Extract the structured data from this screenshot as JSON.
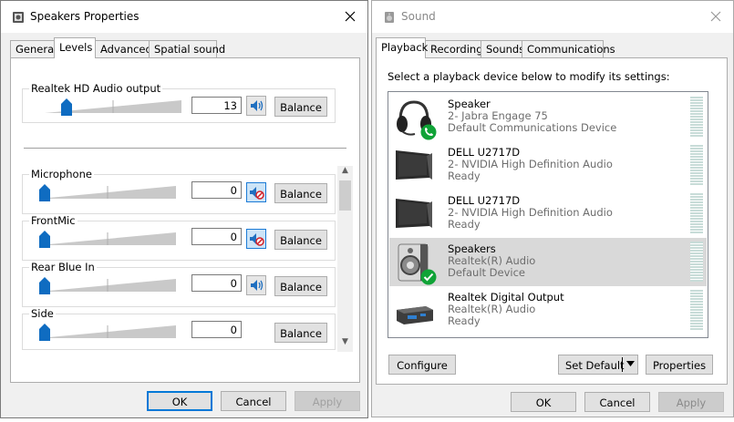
{
  "speakers_props": {
    "title": "Speakers Properties",
    "tabs": [
      {
        "label": "General"
      },
      {
        "label": "Levels"
      },
      {
        "label": "Advanced"
      },
      {
        "label": "Spatial sound"
      }
    ],
    "output": {
      "label": "Realtek HD Audio output",
      "value": "13",
      "level_percent": 13
    },
    "inputs": [
      {
        "label": "Microphone",
        "value": "0",
        "level_percent": 0,
        "muted": true
      },
      {
        "label": "FrontMic",
        "value": "0",
        "level_percent": 0,
        "muted": true
      },
      {
        "label": "Rear Blue In",
        "value": "0",
        "level_percent": 0,
        "muted": false
      },
      {
        "label": "Side",
        "value": "0",
        "level_percent": 0,
        "muted": false
      }
    ],
    "balance_label": "Balance",
    "ok": "OK",
    "cancel": "Cancel",
    "apply": "Apply"
  },
  "sound": {
    "title": "Sound",
    "tabs": [
      {
        "label": "Playback"
      },
      {
        "label": "Recording"
      },
      {
        "label": "Sounds"
      },
      {
        "label": "Communications"
      }
    ],
    "prompt": "Select a playback device below to modify its settings:",
    "devices": [
      {
        "name": "Speaker",
        "line1": "2- Jabra Engage 75",
        "line2": "Default Communications Device",
        "icon": "headset-icon",
        "badge": "phone-badge-icon"
      },
      {
        "name": "DELL U2717D",
        "line1": "2- NVIDIA High Definition Audio",
        "line2": "Ready",
        "icon": "monitor-icon"
      },
      {
        "name": "DELL U2717D",
        "line1": "2- NVIDIA High Definition Audio",
        "line2": "Ready",
        "icon": "monitor-icon"
      },
      {
        "name": "Speakers",
        "line1": "Realtek(R) Audio",
        "line2": "Default Device",
        "icon": "speaker-icon",
        "badge": "check-badge-icon",
        "selected": true
      },
      {
        "name": "Realtek Digital Output",
        "line1": "Realtek(R) Audio",
        "line2": "Ready",
        "icon": "digital-output-icon"
      }
    ],
    "configure": "Configure",
    "set_default": "Set Default",
    "properties": "Properties",
    "ok": "OK",
    "cancel": "Cancel",
    "apply": "Apply"
  },
  "colors": {
    "accent": "#0078d7",
    "slider_thumb": "#0f6cc1",
    "badge_green": "#10a337",
    "selected_row": "#d9d9d9"
  }
}
